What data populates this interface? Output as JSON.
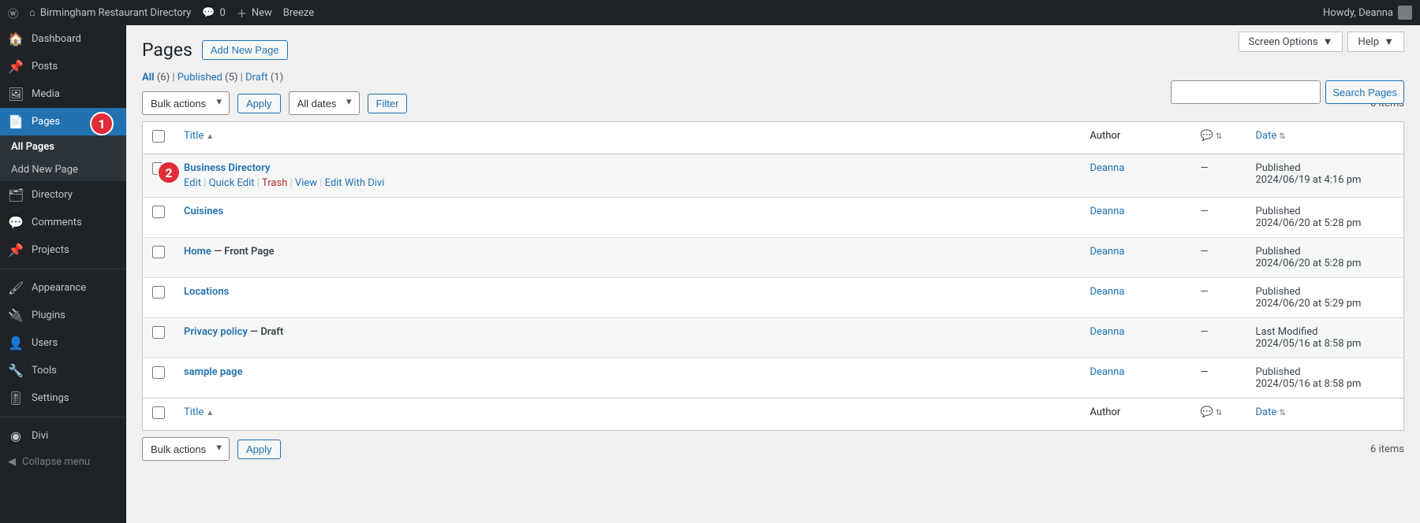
{
  "adminbar": {
    "site_name": "Birmingham Restaurant Directory",
    "comments_count": "0",
    "new_label": "New",
    "breeze_label": "Breeze",
    "howdy": "Howdy, Deanna"
  },
  "sidebar": {
    "dashboard": "Dashboard",
    "posts": "Posts",
    "media": "Media",
    "pages": "Pages",
    "all_pages": "All Pages",
    "add_new_page": "Add New Page",
    "directory": "Directory",
    "comments": "Comments",
    "projects": "Projects",
    "appearance": "Appearance",
    "plugins": "Plugins",
    "users": "Users",
    "tools": "Tools",
    "settings": "Settings",
    "divi": "Divi",
    "collapse": "Collapse menu"
  },
  "tabs": {
    "screen_options": "Screen Options",
    "help": "Help"
  },
  "page": {
    "title": "Pages",
    "add_new": "Add New Page",
    "search_btn": "Search Pages",
    "items_count": "6 items"
  },
  "filters": {
    "all_label": "All",
    "all_count": "(6)",
    "published_label": "Published",
    "published_count": "(5)",
    "draft_label": "Draft",
    "draft_count": "(1)"
  },
  "bulk": {
    "bulk_actions": "Bulk actions",
    "apply": "Apply",
    "all_dates": "All dates",
    "filter": "Filter"
  },
  "columns": {
    "title": "Title",
    "author": "Author",
    "date": "Date"
  },
  "row_actions": {
    "edit": "Edit",
    "quick_edit": "Quick Edit",
    "trash": "Trash",
    "view": "View",
    "divi": "Edit With Divi"
  },
  "rows": [
    {
      "title": "Business Directory",
      "state": "",
      "author": "Deanna",
      "comments": "—",
      "date_status": "Published",
      "date_time": "2024/06/19 at 4:16 pm",
      "show_actions": true
    },
    {
      "title": "Cuisines",
      "state": "",
      "author": "Deanna",
      "comments": "—",
      "date_status": "Published",
      "date_time": "2024/06/20 at 5:28 pm",
      "show_actions": false
    },
    {
      "title": "Home",
      "state": " — Front Page",
      "author": "Deanna",
      "comments": "—",
      "date_status": "Published",
      "date_time": "2024/06/20 at 5:28 pm",
      "show_actions": false
    },
    {
      "title": "Locations",
      "state": "",
      "author": "Deanna",
      "comments": "—",
      "date_status": "Published",
      "date_time": "2024/06/20 at 5:29 pm",
      "show_actions": false
    },
    {
      "title": "Privacy policy",
      "state": " — Draft",
      "author": "Deanna",
      "comments": "—",
      "date_status": "Last Modified",
      "date_time": "2024/05/16 at 8:58 pm",
      "show_actions": false
    },
    {
      "title": "sample page",
      "state": "",
      "author": "Deanna",
      "comments": "—",
      "date_status": "Published",
      "date_time": "2024/05/16 at 8:58 pm",
      "show_actions": false
    }
  ],
  "badges": {
    "one": "1",
    "two": "2"
  }
}
